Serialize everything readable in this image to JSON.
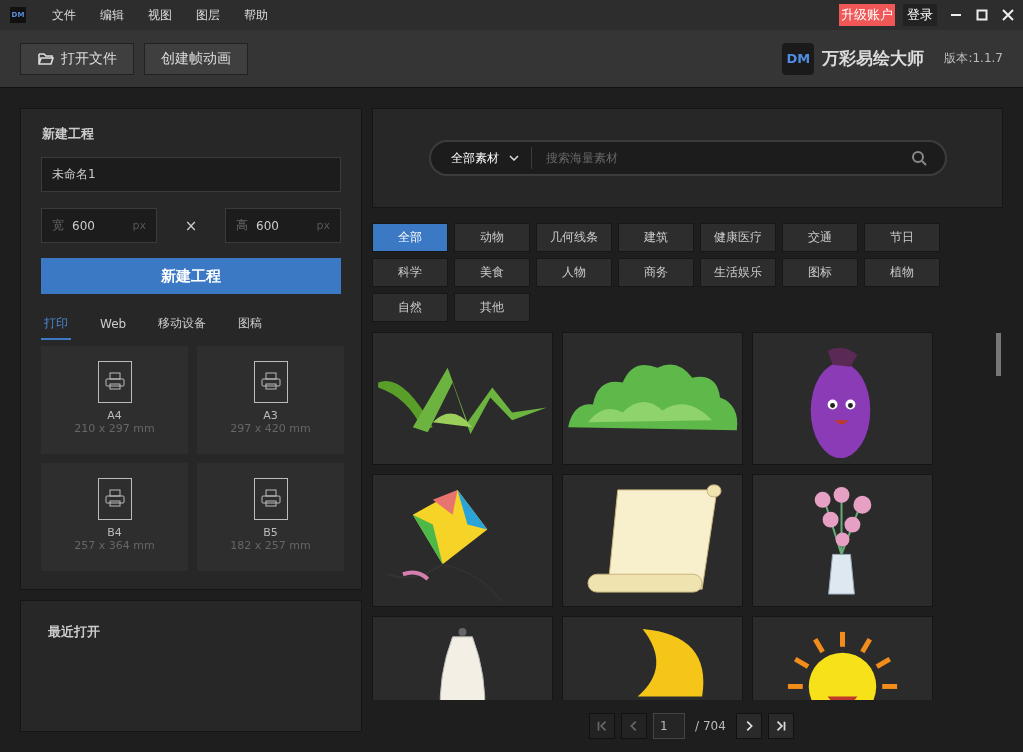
{
  "menu_bar": {
    "logo": "DM",
    "items": [
      "文件",
      "编辑",
      "视图",
      "图层",
      "帮助"
    ],
    "upgrade_button": "升级账户",
    "login_button": "登录"
  },
  "toolbar": {
    "buttons": [
      {
        "label": "打开文件",
        "kind": "folder"
      },
      {
        "label": "创建帧动画",
        "kind": "plain"
      }
    ],
    "app_logo": "DM",
    "app_name": "万彩易绘大师",
    "version": "版本:1.1.7"
  },
  "new_project": {
    "title": "新建工程",
    "name_value": "未命名1",
    "width": {
      "label": "宽",
      "value": "600",
      "unit": "px"
    },
    "times": "×",
    "height": {
      "label": "高",
      "value": "600",
      "unit": "px"
    },
    "create_button": "新建工程",
    "tabs": [
      {
        "label": "打印",
        "selected": true
      },
      {
        "label": "Web",
        "selected": false
      },
      {
        "label": "移动设备",
        "selected": false
      },
      {
        "label": "图稿",
        "selected": false
      }
    ],
    "presets": [
      {
        "name": "A4",
        "size": "210 x 297 mm"
      },
      {
        "name": "A3",
        "size": "297 x 420 mm"
      },
      {
        "name": "B4",
        "size": "257 x 364 mm"
      },
      {
        "name": "B5",
        "size": "182 x 257 mm"
      }
    ]
  },
  "recent": {
    "title": "最近打开"
  },
  "search": {
    "scope": "全部素材",
    "placeholder": "搜索海量素材"
  },
  "categories": [
    {
      "label": "全部",
      "selected": true
    },
    {
      "label": "动物",
      "selected": false
    },
    {
      "label": "几何线条",
      "selected": false
    },
    {
      "label": "建筑",
      "selected": false
    },
    {
      "label": "健康医疗",
      "selected": false
    },
    {
      "label": "交通",
      "selected": false
    },
    {
      "label": "节日",
      "selected": false
    },
    {
      "label": "科学",
      "selected": false
    },
    {
      "label": "美食",
      "selected": false
    },
    {
      "label": "人物",
      "selected": false
    },
    {
      "label": "商务",
      "selected": false
    },
    {
      "label": "生活娱乐",
      "selected": false
    },
    {
      "label": "图标",
      "selected": false
    },
    {
      "label": "植物",
      "selected": false
    },
    {
      "label": "自然",
      "selected": false
    },
    {
      "label": "其他",
      "selected": false
    }
  ],
  "assets": [
    {
      "kind": "grass"
    },
    {
      "kind": "bush"
    },
    {
      "kind": "eggplant"
    },
    {
      "kind": "kite"
    },
    {
      "kind": "scroll"
    },
    {
      "kind": "flowers"
    },
    {
      "kind": "bottle"
    },
    {
      "kind": "moon"
    },
    {
      "kind": "sun"
    }
  ],
  "pagination": {
    "buttons": [
      {
        "kind": "first",
        "disabled": true
      },
      {
        "kind": "prev",
        "disabled": true
      },
      {
        "kind": "next",
        "disabled": false
      },
      {
        "kind": "last",
        "disabled": false
      }
    ],
    "page": "1",
    "total": "/ 704"
  }
}
